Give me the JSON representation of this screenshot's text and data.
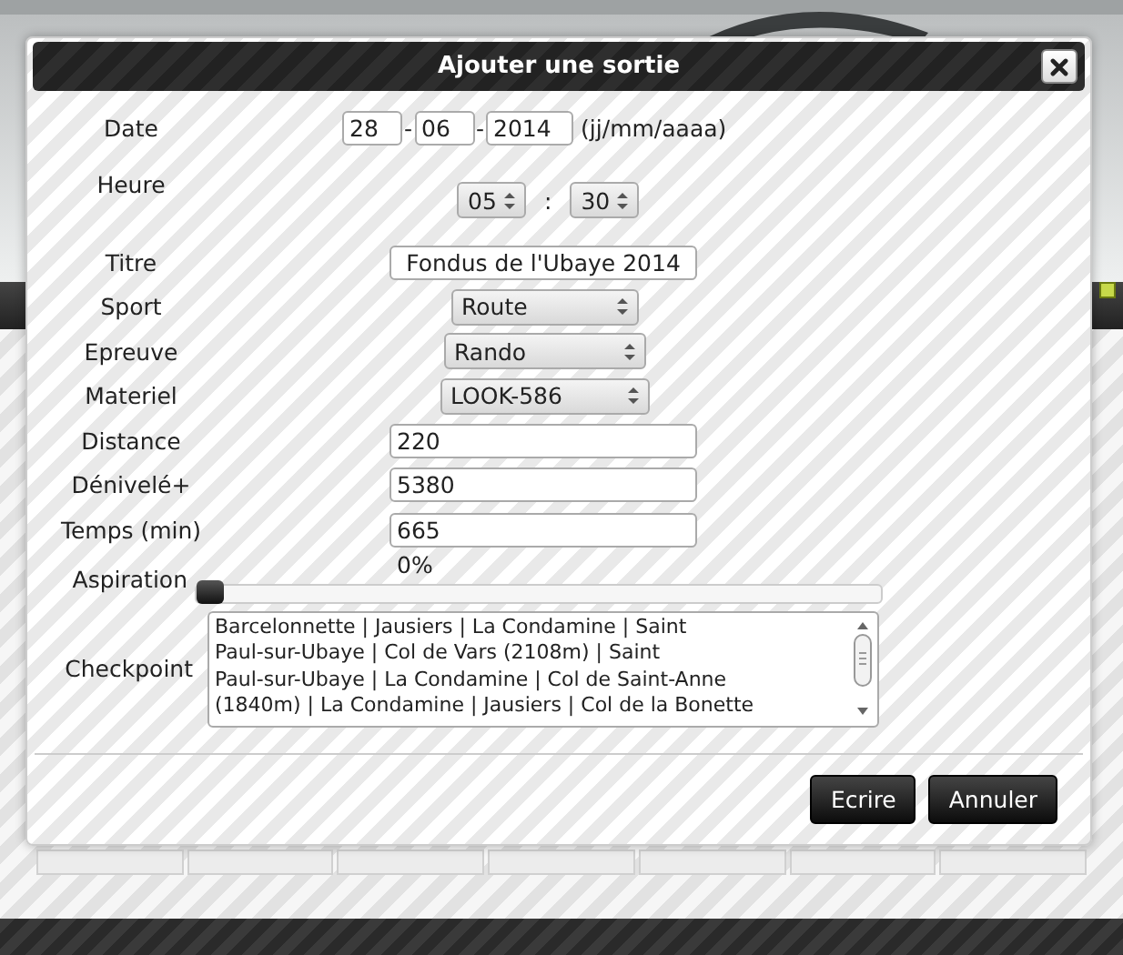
{
  "dialog": {
    "title": "Ajouter une sortie"
  },
  "fields": [
    {
      "kind": "date",
      "label": "Date",
      "day": "28",
      "month": "06",
      "year": "2014",
      "separators": [
        "-",
        "-"
      ],
      "hint": "(jj/mm/aaaa)"
    },
    {
      "kind": "time",
      "label": "Heure",
      "hours": "05",
      "minutes": "30",
      "separator": ":"
    },
    {
      "kind": "title",
      "label": "Titre",
      "value": "Fondus de l'Ubaye 2014"
    },
    {
      "kind": "select",
      "label": "Sport",
      "value": "Route"
    },
    {
      "kind": "select",
      "label": "Epreuve",
      "value": "Rando"
    },
    {
      "kind": "select",
      "label": "Materiel",
      "value": "LOOK-586"
    },
    {
      "kind": "text",
      "label": "Distance",
      "value": "220"
    },
    {
      "kind": "text",
      "label": "Dénivelé+",
      "value": "5380"
    },
    {
      "kind": "text",
      "label": "Temps (min)",
      "value": "665"
    },
    {
      "kind": "slider",
      "label": "Aspiration",
      "reading": "0%",
      "level": 0
    },
    {
      "kind": "textarea",
      "label": "Checkpoint",
      "lines": [
        "Barcelonnette | Jausiers | La Condamine | Saint",
        "Paul-sur-Ubaye | Col de Vars (2108m) | Saint",
        "Paul-sur-Ubaye | La Condamine | Col de Saint-Anne",
        "(1840m) | La Condamine | Jausiers | Col de la Bonette"
      ]
    }
  ],
  "buttons": [
    "Ecrire",
    "Annuler"
  ]
}
